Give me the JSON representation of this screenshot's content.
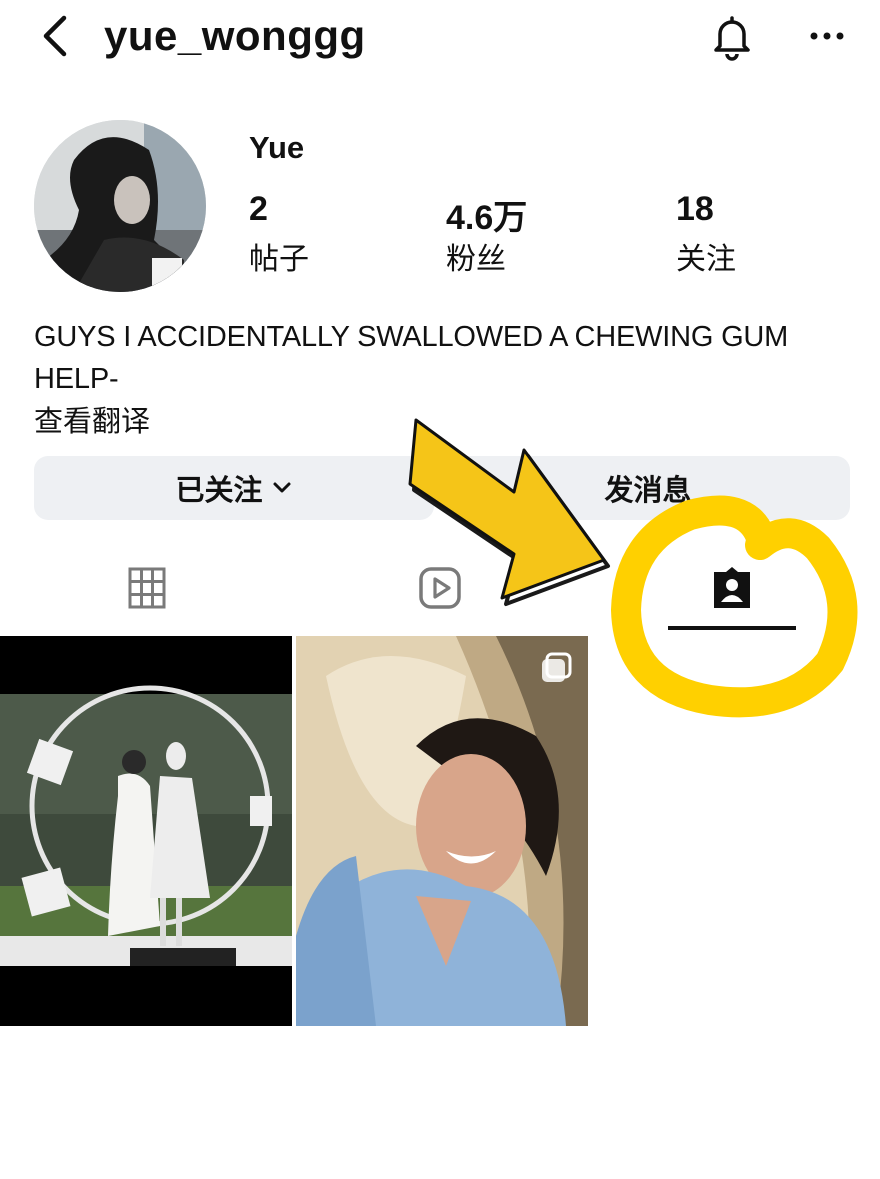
{
  "header": {
    "username": "yue_wonggg",
    "back_icon": "chevron-left-icon",
    "bell_icon": "bell-icon",
    "more_icon": "more-horizontal-icon"
  },
  "profile": {
    "display_name": "Yue",
    "stats": [
      {
        "value": "2",
        "label": "帖子"
      },
      {
        "value": "4.6万",
        "label": "粉丝"
      },
      {
        "value": "18",
        "label": "关注"
      }
    ],
    "bio": "GUYS I ACCIDENTALLY SWALLOWED A CHEWING GUM HELP-",
    "translate_link": "查看翻译"
  },
  "actions": {
    "following_label": "已关注",
    "message_label": "发消息"
  },
  "tabs": [
    {
      "icon": "grid-icon",
      "selected": false
    },
    {
      "icon": "reels-play-icon",
      "selected": false
    },
    {
      "icon": "tagged-person-icon",
      "selected": true
    }
  ],
  "annotation": {
    "arrow_color": "#f5c518",
    "circle_color": "#ffd000"
  },
  "posts": [
    {
      "icon": null
    },
    {
      "icon": "carousel-icon"
    }
  ]
}
